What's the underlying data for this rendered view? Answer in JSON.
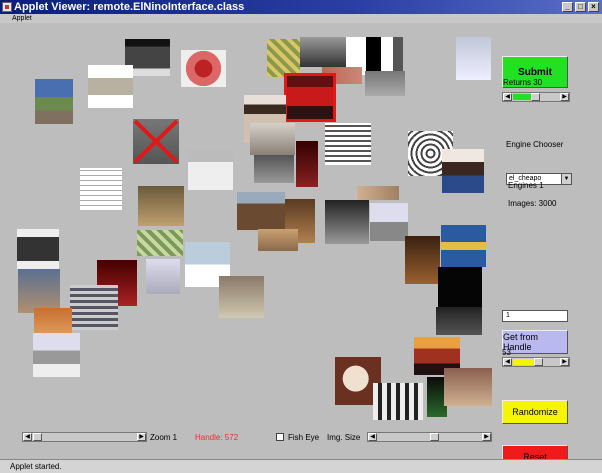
{
  "window": {
    "title": "Applet Viewer: remote.ElNinoInterface.class",
    "menu": "Applet"
  },
  "controls": {
    "submit_label": "Submit",
    "returns_label": "Returns 30",
    "returns_value": 0.45,
    "engine_chooser_label": "Engine Chooser",
    "engine_selected": "el_cheapo",
    "engines_text": "Engines 1",
    "images_text": "Images: 3000",
    "handle_value": "1",
    "get_handle_label": "Get from Handle",
    "slider2_label": "53",
    "slider2_value": 0.53,
    "randomize_label": "Randomize",
    "reset_label": "Reset"
  },
  "bottom": {
    "zoom_label": "Zoom 1",
    "handle_text": "Handle: 572",
    "handle_color": "#e83030",
    "fisheye_label": "Fish Eye",
    "imgsize_label": "Img. Size",
    "imgsize_value": 0.54
  },
  "status": "Applet started.",
  "colors": {
    "submit": "#22e022",
    "get_handle": "#b9b9f0",
    "randomize": "#f5f500",
    "reset": "#f01a1a",
    "selection": "#e01818"
  }
}
